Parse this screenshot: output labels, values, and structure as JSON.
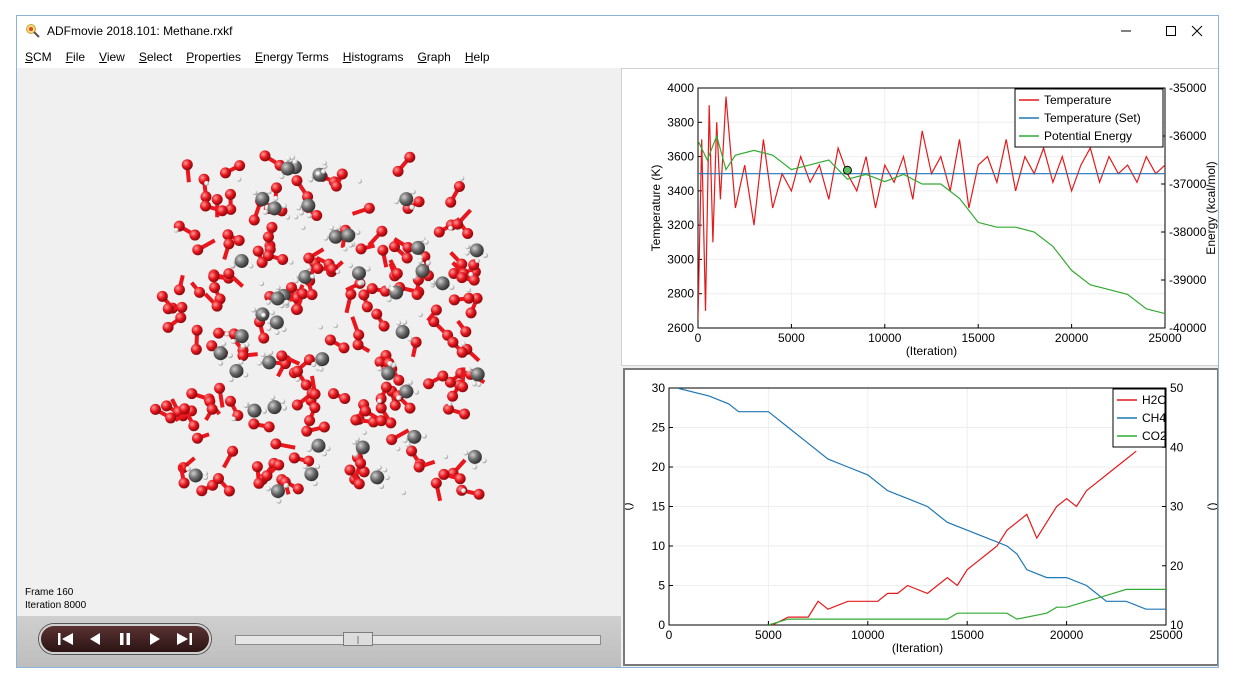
{
  "window": {
    "title": "ADFmovie 2018.101: Methane.rxkf"
  },
  "menu": [
    "SCM",
    "File",
    "View",
    "Select",
    "Properties",
    "Energy Terms",
    "Histograms",
    "Graph",
    "Help"
  ],
  "frame": {
    "frame_label": "Frame 160",
    "iteration_label": "Iteration 8000",
    "slider_value": 0.32
  },
  "colors": {
    "temperature": "#e31a1c",
    "temperature_set": "#1f77b4",
    "potential_energy": "#33aa33",
    "h2o": "#e31a1c",
    "ch4": "#1f77b4",
    "co2": "#33aa33",
    "oxygen": "#e8161d",
    "carbon": "#6b6b6b",
    "hydrogen": "#e8e8e8"
  },
  "chart_data": [
    {
      "type": "line",
      "xlabel": "(Iteration)",
      "ylabel": "Temperature (K)",
      "y2label": "Energy (kcal/mol)",
      "xlim": [
        0,
        25000
      ],
      "ylim": [
        2600,
        4000
      ],
      "y2lim": [
        -40000,
        -35000
      ],
      "x_ticks": [
        "0",
        "5000",
        "10000",
        "15000",
        "20000",
        "25000"
      ],
      "y_ticks": [
        "2600",
        "2800",
        "3000",
        "3200",
        "3400",
        "3600",
        "3800",
        "4000"
      ],
      "y2_ticks": [
        "-40000",
        "-39000",
        "-38000",
        "-37000",
        "-36000",
        "-35000"
      ],
      "legend_position": "top-right",
      "grid": true,
      "marker": {
        "x": 8000,
        "y": 3520
      },
      "series": [
        {
          "name": "Temperature",
          "axis": "left",
          "x": [
            0,
            200,
            400,
            600,
            800,
            1000,
            1200,
            1500,
            2000,
            2500,
            3000,
            3500,
            4000,
            4500,
            5000,
            5500,
            6000,
            6500,
            7000,
            7500,
            8000,
            8500,
            9000,
            9500,
            10000,
            10500,
            11000,
            11500,
            12000,
            12500,
            13000,
            13500,
            14000,
            14500,
            15000,
            15500,
            16000,
            16500,
            17000,
            17500,
            18000,
            18500,
            19000,
            19500,
            20000,
            20500,
            21000,
            21500,
            22000,
            22500,
            23000,
            23500,
            24000,
            24500,
            25000
          ],
          "values": [
            2650,
            3700,
            2700,
            3900,
            3100,
            3800,
            3350,
            3950,
            3300,
            3550,
            3200,
            3700,
            3300,
            3500,
            3400,
            3600,
            3450,
            3550,
            3350,
            3650,
            3500,
            3400,
            3600,
            3300,
            3550,
            3450,
            3600,
            3350,
            3750,
            3500,
            3600,
            3400,
            3700,
            3300,
            3550,
            3600,
            3450,
            3700,
            3400,
            3600,
            3500,
            3650,
            3450,
            3600,
            3400,
            3550,
            3650,
            3450,
            3600,
            3500,
            3550,
            3450,
            3600,
            3500,
            3550
          ]
        },
        {
          "name": "Temperature (Set)",
          "axis": "left",
          "x": [
            0,
            25000
          ],
          "values": [
            3500,
            3500
          ]
        },
        {
          "name": "Potential Energy",
          "axis": "right",
          "x": [
            0,
            500,
            1000,
            1500,
            2000,
            3000,
            4000,
            5000,
            6000,
            7000,
            8000,
            9000,
            10000,
            11000,
            12000,
            13000,
            14000,
            15000,
            16000,
            17000,
            18000,
            19000,
            20000,
            21000,
            22000,
            23000,
            24000,
            25000
          ],
          "values": [
            -36100,
            -36500,
            -36000,
            -36700,
            -36400,
            -36300,
            -36400,
            -36700,
            -36600,
            -36500,
            -36900,
            -36800,
            -36950,
            -36800,
            -37000,
            -37000,
            -37300,
            -37800,
            -37900,
            -37900,
            -38000,
            -38300,
            -38800,
            -39100,
            -39200,
            -39300,
            -39600,
            -39700
          ]
        }
      ]
    },
    {
      "type": "line",
      "xlabel": "(Iteration)",
      "ylabel": "()",
      "y2label": "()",
      "xlim": [
        0,
        25000
      ],
      "ylim": [
        0,
        30
      ],
      "y2lim": [
        10,
        50
      ],
      "x_ticks": [
        "0",
        "5000",
        "10000",
        "15000",
        "20000",
        "25000"
      ],
      "y_ticks": [
        "0",
        "5",
        "10",
        "15",
        "20",
        "25",
        "30"
      ],
      "y2_ticks": [
        "10",
        "20",
        "30",
        "40",
        "50"
      ],
      "legend_position": "top-right",
      "grid": true,
      "series": [
        {
          "name": "H2O",
          "axis": "left",
          "x": [
            5200,
            6000,
            7000,
            7500,
            8000,
            9000,
            10000,
            10500,
            11000,
            11500,
            12000,
            13000,
            14000,
            14500,
            15000,
            15500,
            16000,
            16500,
            17000,
            17500,
            18000,
            18500,
            19000,
            19500,
            20000,
            20500,
            21000,
            21500,
            22000,
            22500,
            23000,
            23500
          ],
          "values": [
            0,
            1,
            1,
            3,
            2,
            3,
            3,
            3,
            4,
            4,
            5,
            4,
            6,
            5,
            7,
            8,
            9,
            10,
            12,
            13,
            14,
            11,
            13,
            15,
            16,
            15,
            17,
            18,
            19,
            20,
            21,
            22
          ]
        },
        {
          "name": "CH4",
          "axis": "left",
          "x": [
            400,
            2000,
            3000,
            3500,
            4000,
            5000,
            6000,
            7000,
            8000,
            9000,
            10000,
            11000,
            12000,
            13000,
            14000,
            15000,
            16000,
            17000,
            17500,
            18000,
            19000,
            20000,
            21000,
            21500,
            22000,
            23000,
            24000,
            25000
          ],
          "values": [
            30,
            29,
            28,
            27,
            27,
            27,
            25,
            23,
            21,
            20,
            19,
            17,
            16,
            15,
            13,
            12,
            11,
            10,
            9,
            7,
            6,
            6,
            5,
            4,
            3,
            3,
            2,
            2
          ]
        },
        {
          "name": "CO2",
          "axis": "right",
          "x": [
            5000,
            6000,
            8000,
            10000,
            12000,
            14000,
            14500,
            17000,
            17500,
            19000,
            19500,
            20000,
            21000,
            22000,
            23000,
            25000
          ],
          "values": [
            10,
            11,
            11,
            11,
            11,
            11,
            12,
            12,
            11,
            12,
            13,
            13,
            14,
            15,
            16,
            16
          ]
        }
      ]
    }
  ]
}
